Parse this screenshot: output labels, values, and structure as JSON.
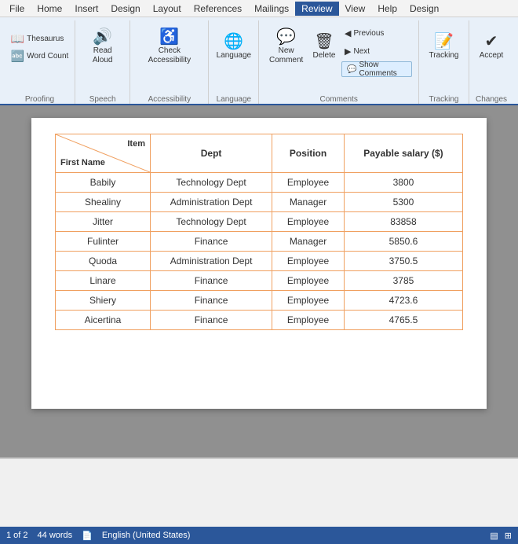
{
  "menubar": {
    "items": [
      "File",
      "Home",
      "Insert",
      "Design",
      "Layout",
      "References",
      "Mailings",
      "Review",
      "View",
      "Help",
      "Design"
    ]
  },
  "ribbon": {
    "active_tab": "Review",
    "tabs": [
      "File",
      "Home",
      "Insert",
      "Design",
      "Layout",
      "References",
      "Mailings",
      "Review",
      "View",
      "Help",
      "Design"
    ],
    "groups": {
      "proofing": {
        "label": "Proofing",
        "buttons": {
          "thesaurus": "Thesaurus",
          "word_count": "Word Count"
        }
      },
      "speech": {
        "label": "Speech",
        "read_aloud": "Read\nAloud"
      },
      "accessibility": {
        "label": "Accessibility",
        "check": "Check\nAccessibility"
      },
      "language": {
        "label": "Language",
        "language_btn": "Language"
      },
      "comments": {
        "label": "Comments",
        "new_comment": "New\nComment",
        "delete": "Delete",
        "previous": "Previous",
        "next": "Next",
        "show_comments": "Show Comments"
      },
      "tracking": {
        "label": "Tracking",
        "tracking_btn": "Tracking"
      },
      "changes": {
        "label": "Changes",
        "accept": "Accept"
      }
    }
  },
  "table": {
    "columns": [
      "Item\n/\nFirst Name",
      "Dept",
      "Position",
      "Payable salary ($)"
    ],
    "header_item": "Item",
    "header_firstname": "First Name",
    "rows": [
      {
        "name": "Babily",
        "dept": "Technology Dept",
        "position": "Employee",
        "salary": "3800"
      },
      {
        "name": "Shealiny",
        "dept": "Administration Dept",
        "position": "Manager",
        "salary": "5300"
      },
      {
        "name": "Jitter",
        "dept": "Technology Dept",
        "position": "Employee",
        "salary": "83858"
      },
      {
        "name": "Fulinter",
        "dept": "Finance",
        "position": "Manager",
        "salary": "5850.6"
      },
      {
        "name": "Quoda",
        "dept": "Administration Dept",
        "position": "Employee",
        "salary": "3750.5"
      },
      {
        "name": "Linare",
        "dept": "Finance",
        "position": "Employee",
        "salary": "3785"
      },
      {
        "name": "Shiery",
        "dept": "Finance",
        "position": "Employee",
        "salary": "4723.6"
      },
      {
        "name": "Aicertina",
        "dept": "Finance",
        "position": "Employee",
        "salary": "4765.5"
      }
    ]
  },
  "statusbar": {
    "page": "1 of 2",
    "words": "44 words",
    "language": "English (United States)"
  },
  "colors": {
    "ribbon_bg": "#e8f0f9",
    "active_tab": "#2b579a",
    "table_border": "#f0a060",
    "status_bar": "#2b579a"
  }
}
